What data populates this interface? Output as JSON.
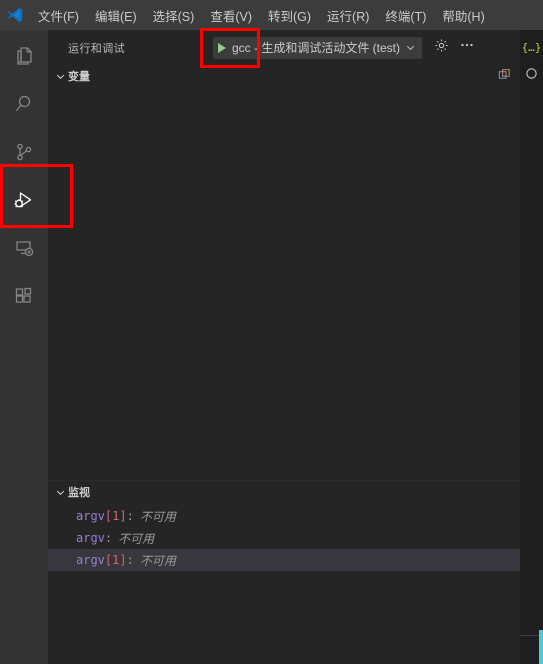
{
  "menubar": {
    "logo_icon": "vscode-logo",
    "items": [
      {
        "label": "文件(F)",
        "name": "menu-file"
      },
      {
        "label": "编辑(E)",
        "name": "menu-edit"
      },
      {
        "label": "选择(S)",
        "name": "menu-selection"
      },
      {
        "label": "查看(V)",
        "name": "menu-view"
      },
      {
        "label": "转到(G)",
        "name": "menu-go"
      },
      {
        "label": "运行(R)",
        "name": "menu-run"
      },
      {
        "label": "终端(T)",
        "name": "menu-terminal"
      },
      {
        "label": "帮助(H)",
        "name": "menu-help"
      }
    ]
  },
  "activitybar": {
    "items": [
      {
        "name": "activity-explorer",
        "icon": "files-icon",
        "active": false
      },
      {
        "name": "activity-search",
        "icon": "search-icon",
        "active": false
      },
      {
        "name": "activity-source-control",
        "icon": "source-control-icon",
        "active": false
      },
      {
        "name": "activity-run-debug",
        "icon": "run-and-debug-icon",
        "active": true
      },
      {
        "name": "activity-remote",
        "icon": "remote-explorer-icon",
        "active": false
      },
      {
        "name": "activity-extensions",
        "icon": "extensions-icon",
        "active": false
      }
    ]
  },
  "sidebar": {
    "title": "运行和调试",
    "debug_toolbar": {
      "config_label": "gcc - 生成和调试活动文件 (test)",
      "start_icon": "play-icon",
      "dropdown_icon": "chevron-down-icon",
      "gear_icon": "gear-icon",
      "more_icon": "ellipsis-icon",
      "accent_color": "#89d185"
    },
    "variables_section": {
      "title": "变量",
      "twisty_icon": "chevron-down-icon",
      "action_icon": "open-editors-icon"
    },
    "watch_section": {
      "title": "监视",
      "twisty_icon": "chevron-down-icon",
      "rows": [
        {
          "name": "argv",
          "index": "[1]",
          "colon": ":",
          "value": "不可用",
          "selected": false
        },
        {
          "name": "argv",
          "index": "",
          "colon": ":",
          "value": "不可用",
          "selected": false
        },
        {
          "name": "argv",
          "index": "[1]",
          "colon": ":",
          "value": "不可用",
          "selected": true
        }
      ]
    }
  },
  "editor": {
    "tab_icon": "json-file-icon",
    "tab_icon_glyph": "{…}",
    "breadcrumb_icon": "symbol-circle-icon"
  },
  "annotations": [
    {
      "name": "annotation-box-activity-run-debug",
      "color": "#fe0000"
    },
    {
      "name": "annotation-box-debug-config",
      "color": "#fe0000"
    }
  ]
}
